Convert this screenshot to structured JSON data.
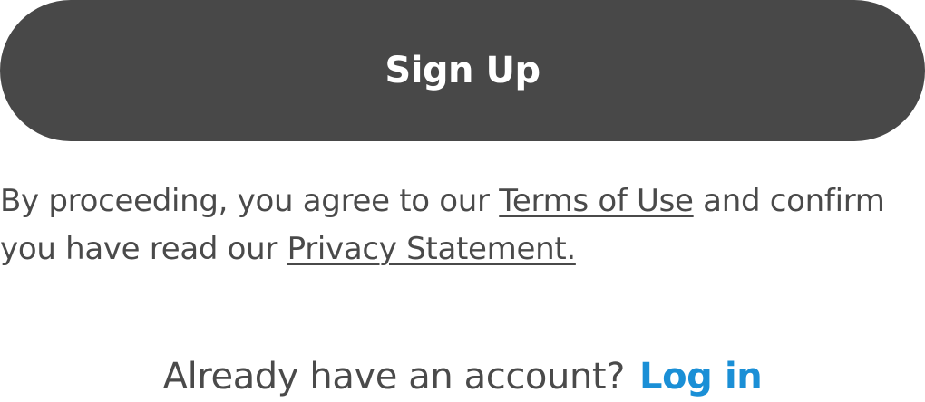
{
  "signup": {
    "label": "Sign Up"
  },
  "terms": {
    "prefix": "By proceeding, you agree to our ",
    "terms_link": "Terms of Use",
    "middle": " and confirm",
    "line2_prefix": "you have read our ",
    "privacy_link": "Privacy Statement."
  },
  "login": {
    "prompt": "Already have an account?",
    "link": "Log in"
  },
  "colors": {
    "button_bg": "#484848",
    "text": "#4a4a4a",
    "link_accent": "#1a8fd6"
  }
}
